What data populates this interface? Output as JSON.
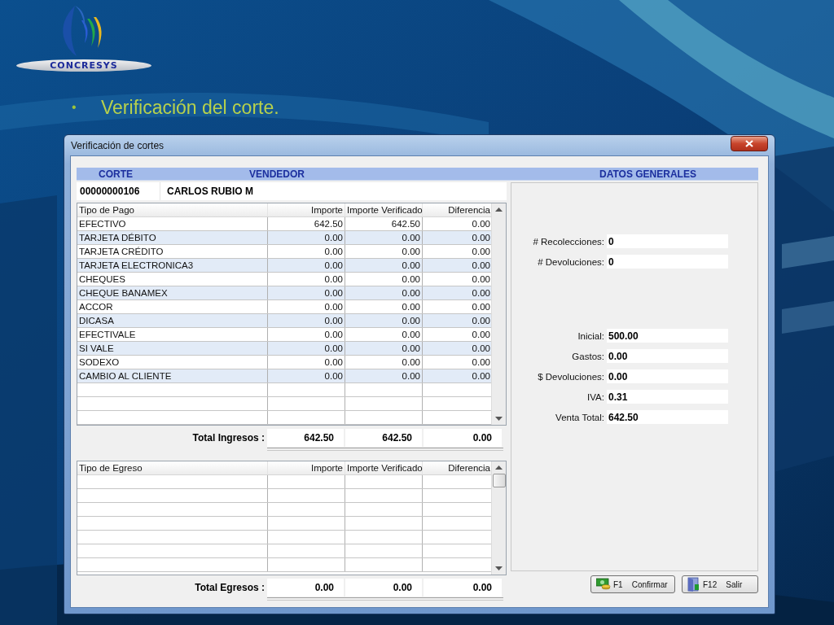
{
  "slide": {
    "logo_text": "CONCRESYS",
    "bullet": "•",
    "title": "Verificación del corte."
  },
  "window": {
    "title": "Verificación de cortes"
  },
  "header": {
    "corte_label": "CORTE",
    "vendedor_label": "VENDEDOR",
    "datos_label": "DATOS GENERALES",
    "corte": "00000000106",
    "vendedor": "CARLOS RUBIO M"
  },
  "ingresos": {
    "columns": [
      "Tipo de Pago",
      "Importe",
      "Importe Verificado",
      "Diferencia"
    ],
    "rows": [
      [
        "EFECTIVO",
        "642.50",
        "642.50",
        "0.00"
      ],
      [
        "TARJETA DÉBITO",
        "0.00",
        "0.00",
        "0.00"
      ],
      [
        "TARJETA CRÉDITO",
        "0.00",
        "0.00",
        "0.00"
      ],
      [
        "TARJETA ELECTRONICA3",
        "0.00",
        "0.00",
        "0.00"
      ],
      [
        "CHEQUES",
        "0.00",
        "0.00",
        "0.00"
      ],
      [
        "CHEQUE BANAMEX",
        "0.00",
        "0.00",
        "0.00"
      ],
      [
        "ACCOR",
        "0.00",
        "0.00",
        "0.00"
      ],
      [
        "DICASA",
        "0.00",
        "0.00",
        "0.00"
      ],
      [
        "EFECTIVALE",
        "0.00",
        "0.00",
        "0.00"
      ],
      [
        "SI VALE",
        "0.00",
        "0.00",
        "0.00"
      ],
      [
        "SODEXO",
        "0.00",
        "0.00",
        "0.00"
      ],
      [
        "CAMBIO AL CLIENTE",
        "0.00",
        "0.00",
        "0.00"
      ]
    ],
    "total_label": "Total Ingresos :",
    "totals": [
      "642.50",
      "642.50",
      "0.00"
    ]
  },
  "egresos": {
    "columns": [
      "Tipo de Egreso",
      "Importe",
      "Importe Verificado",
      "Diferencia"
    ],
    "total_label": "Total Egresos :",
    "totals": [
      "0.00",
      "0.00",
      "0.00"
    ]
  },
  "conteos": [
    {
      "label": "# Recolecciones:",
      "value": "0"
    },
    {
      "label": "# Devoluciones:",
      "value": "0"
    }
  ],
  "importes": [
    {
      "label": "Inicial:",
      "value": "500.00"
    },
    {
      "label": "Gastos:",
      "value": "0.00"
    },
    {
      "label": "$ Devoluciones:",
      "value": "0.00"
    },
    {
      "label": "IVA:",
      "value": "0.31"
    },
    {
      "label": "Venta Total:",
      "value": "642.50"
    }
  ],
  "buttons": [
    {
      "kind": "confirm",
      "key": "F1",
      "label": "Confirmar"
    },
    {
      "kind": "exit",
      "key": "F12",
      "label": "Salir"
    }
  ]
}
